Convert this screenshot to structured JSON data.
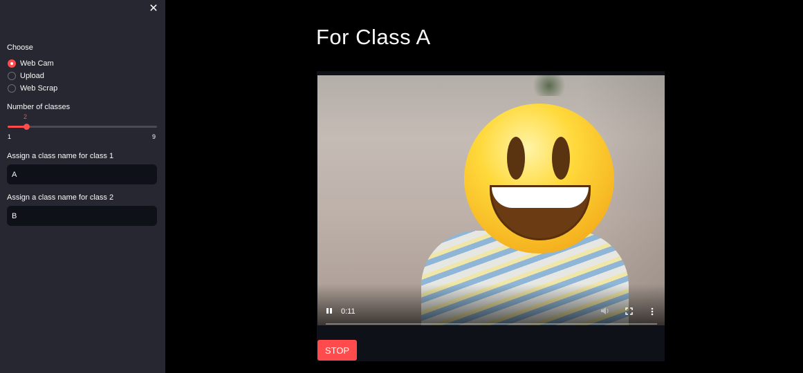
{
  "sidebar": {
    "close_glyph": "✕",
    "choose_label": "Choose",
    "radio_options": [
      {
        "label": "Web Cam",
        "checked": true
      },
      {
        "label": "Upload",
        "checked": false
      },
      {
        "label": "Web Scrap",
        "checked": false
      }
    ],
    "slider": {
      "label": "Number of classes",
      "value": "2",
      "min": "1",
      "max": "9",
      "fraction": 0.125
    },
    "class_inputs": [
      {
        "label": "Assign a class name for class 1",
        "value": "A"
      },
      {
        "label": "Assign a class name for class 2",
        "value": "B"
      }
    ]
  },
  "main": {
    "title": "For Class A",
    "video": {
      "time": "0:11",
      "progress_fraction": 0.0,
      "play_state_icon": "pause-icon",
      "icons": [
        "pause-icon",
        "volume-icon",
        "fullscreen-icon",
        "more-vert-icon"
      ]
    },
    "stop_label": "STOP"
  },
  "colors": {
    "accent": "#ff4b4b",
    "sidebar_bg": "#262730",
    "input_bg": "#0e1117",
    "page_bg": "#000000"
  }
}
